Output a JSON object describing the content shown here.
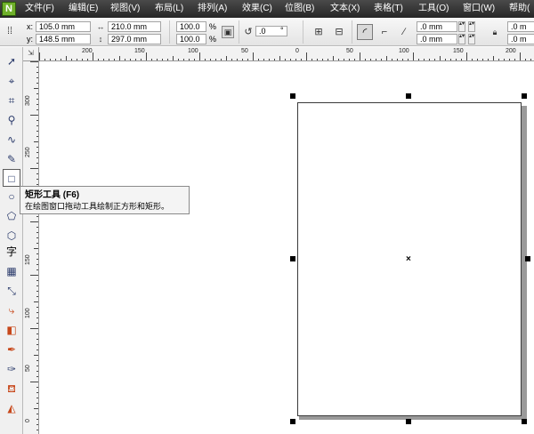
{
  "menubar": {
    "logo": "N",
    "items": [
      "文件(F)",
      "编辑(E)",
      "视图(V)",
      "布局(L)",
      "排列(A)",
      "效果(C)",
      "位图(B)",
      "文本(X)",
      "表格(T)",
      "工具(O)",
      "窗口(W)",
      "帮助("
    ]
  },
  "propbar": {
    "x_label": "x:",
    "x_value": "105.0 mm",
    "y_label": "y:",
    "y_value": "148.5 mm",
    "width_value": "210.0 mm",
    "height_value": "297.0 mm",
    "scale_x_value": "100.0",
    "scale_y_value": "100.0",
    "percent_symbol": "%",
    "rotation_value": ".0",
    "degree_symbol": "°",
    "corner_1_value": ".0 mm",
    "corner_2_value": ".0 mm",
    "corner_3_value": ".0 m",
    "corner_4_value": ".0 m"
  },
  "ruler": {
    "unit": "mm",
    "top_ticks": [
      "200",
      "150",
      "100",
      "50",
      "0",
      "50",
      "100",
      "150",
      "200"
    ],
    "left_ticks": [
      "300",
      "250",
      "200",
      "150",
      "100",
      "50",
      "0"
    ]
  },
  "toolbox": {
    "tools": [
      {
        "name": "pick-tool",
        "icon": "pick-arrow-icon"
      },
      {
        "name": "shape-tool",
        "icon": "shape-node-icon"
      },
      {
        "name": "crop-tool",
        "icon": "crop-icon"
      },
      {
        "name": "zoom-tool",
        "icon": "zoom-icon"
      },
      {
        "name": "freehand-tool",
        "icon": "freehand-icon"
      },
      {
        "name": "smart-fill-tool",
        "icon": "smart-fill-icon"
      },
      {
        "name": "rectangle-tool",
        "icon": "rectangle-icon",
        "active": true
      },
      {
        "name": "ellipse-tool",
        "icon": "ellipse-icon"
      },
      {
        "name": "polygon-tool",
        "icon": "polygon-icon"
      },
      {
        "name": "basic-shapes-tool",
        "icon": "basic-shapes-icon"
      },
      {
        "name": "text-tool",
        "icon": "text-icon",
        "label": "字"
      },
      {
        "name": "table-tool",
        "icon": "table-icon"
      },
      {
        "name": "dimension-tool",
        "icon": "dimension-icon"
      },
      {
        "name": "connector-tool",
        "icon": "connector-icon"
      },
      {
        "name": "blend-tool",
        "icon": "blend-icon"
      },
      {
        "name": "eyedropper-tool",
        "icon": "eyedropper-icon"
      },
      {
        "name": "outline-tool",
        "icon": "outline-pen-icon"
      },
      {
        "name": "fill-tool",
        "icon": "fill-bucket-icon"
      },
      {
        "name": "interactive-fill-tool",
        "icon": "interactive-fill-icon"
      }
    ]
  },
  "tooltip": {
    "title": "矩形工具 (F6)",
    "description": "在绘图窗口拖动工具绘制正方形和矩形。"
  },
  "colors": {
    "menubar_bg": "#2e2e2e",
    "propbar_bg": "#ececec",
    "canvas_bg": "#ffffff",
    "page_border": "#3a3a3a",
    "page_shadow": "#9a9a9a"
  }
}
